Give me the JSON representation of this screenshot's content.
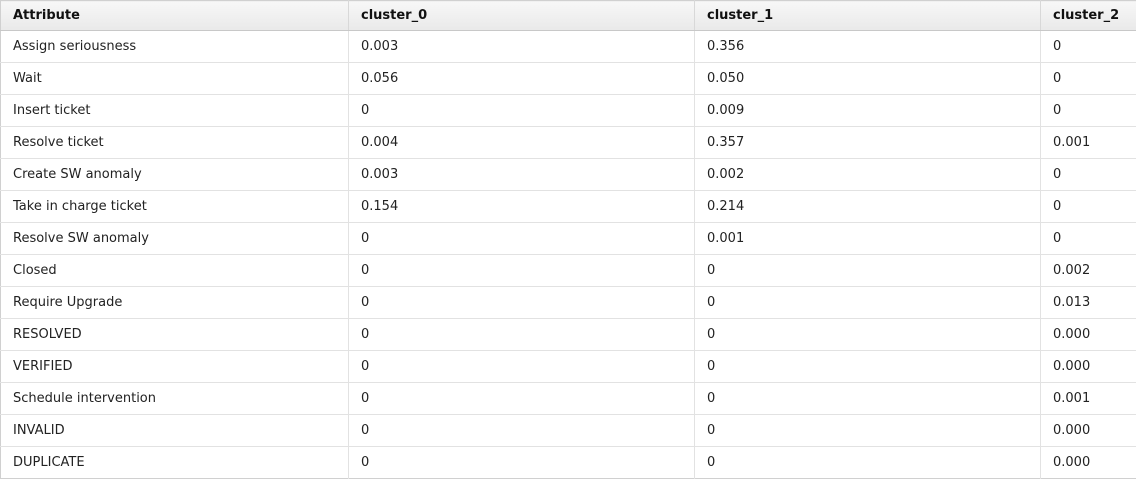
{
  "table": {
    "columns": [
      "Attribute",
      "cluster_0",
      "cluster_1",
      "cluster_2"
    ],
    "rows": [
      [
        "Assign seriousness",
        "0.003",
        "0.356",
        "0"
      ],
      [
        "Wait",
        "0.056",
        "0.050",
        "0"
      ],
      [
        "Insert ticket",
        "0",
        "0.009",
        "0"
      ],
      [
        "Resolve ticket",
        "0.004",
        "0.357",
        "0.001"
      ],
      [
        "Create SW anomaly",
        "0.003",
        "0.002",
        "0"
      ],
      [
        "Take in charge ticket",
        "0.154",
        "0.214",
        "0"
      ],
      [
        "Resolve SW anomaly",
        "0",
        "0.001",
        "0"
      ],
      [
        "Closed",
        "0",
        "0",
        "0.002"
      ],
      [
        "Require Upgrade",
        "0",
        "0",
        "0.013"
      ],
      [
        "RESOLVED",
        "0",
        "0",
        "0.000"
      ],
      [
        "VERIFIED",
        "0",
        "0",
        "0.000"
      ],
      [
        "Schedule intervention",
        "0",
        "0",
        "0.001"
      ],
      [
        "INVALID",
        "0",
        "0",
        "0.000"
      ],
      [
        "DUPLICATE",
        "0",
        "0",
        "0.000"
      ]
    ]
  }
}
